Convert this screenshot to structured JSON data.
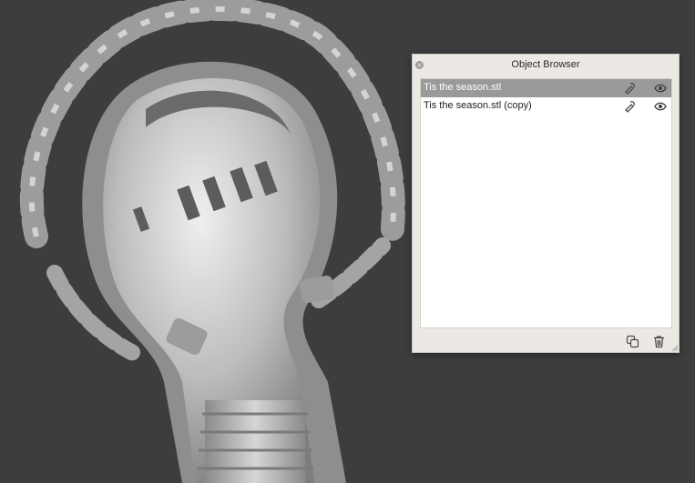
{
  "object_browser": {
    "title": "Object Browser",
    "close_glyph": "×",
    "items": [
      {
        "label": "Tis the season.stl",
        "selected": true,
        "edit_icon": "paint-pointer-icon",
        "visibility_icon": "eye-icon"
      },
      {
        "label": "Tis the season.stl (copy)",
        "selected": false,
        "edit_icon": "paint-pointer-icon",
        "visibility_icon": "eye-icon"
      }
    ],
    "footer": {
      "copy_icon": "duplicate-icon",
      "delete_icon": "trash-icon"
    }
  },
  "colors": {
    "viewport_background": "#3d3d3d",
    "model": "#b8b8b8",
    "panel": "#ece9e4",
    "selected_row": "#9a9a9a"
  }
}
